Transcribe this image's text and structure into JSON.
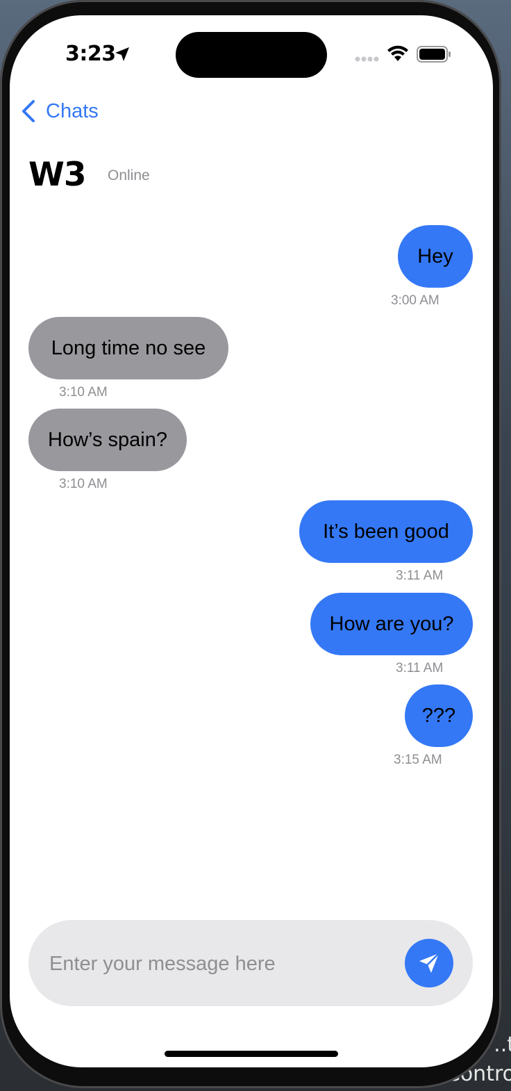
{
  "status_bar": {
    "time": "3:23"
  },
  "nav": {
    "back_label": "Chats"
  },
  "contact": {
    "name": "W3",
    "status": "Online"
  },
  "messages": [
    {
      "text": "Hey",
      "time": "3:00 AM",
      "direction": "outgoing"
    },
    {
      "text": "Long time no see",
      "time": "3:10 AM",
      "direction": "incoming"
    },
    {
      "text": "How’s spain?",
      "time": "3:10 AM",
      "direction": "incoming"
    },
    {
      "text": "It’s been good",
      "time": "3:11 AM",
      "direction": "outgoing"
    },
    {
      "text": "How are you?",
      "time": "3:11 AM",
      "direction": "outgoing"
    },
    {
      "text": "???",
      "time": "3:15 AM",
      "direction": "outgoing"
    }
  ],
  "composer": {
    "placeholder": "Enter your message here",
    "value": ""
  },
  "background_text": {
    "line1": "..t",
    "line2": "iContro"
  },
  "colors": {
    "accent": "#3478f6",
    "incoming_bubble": "#98989d",
    "input_bg": "#e8e8ea"
  },
  "icons": {
    "send": "send-paper-plane-icon",
    "back": "chevron-left-icon"
  }
}
